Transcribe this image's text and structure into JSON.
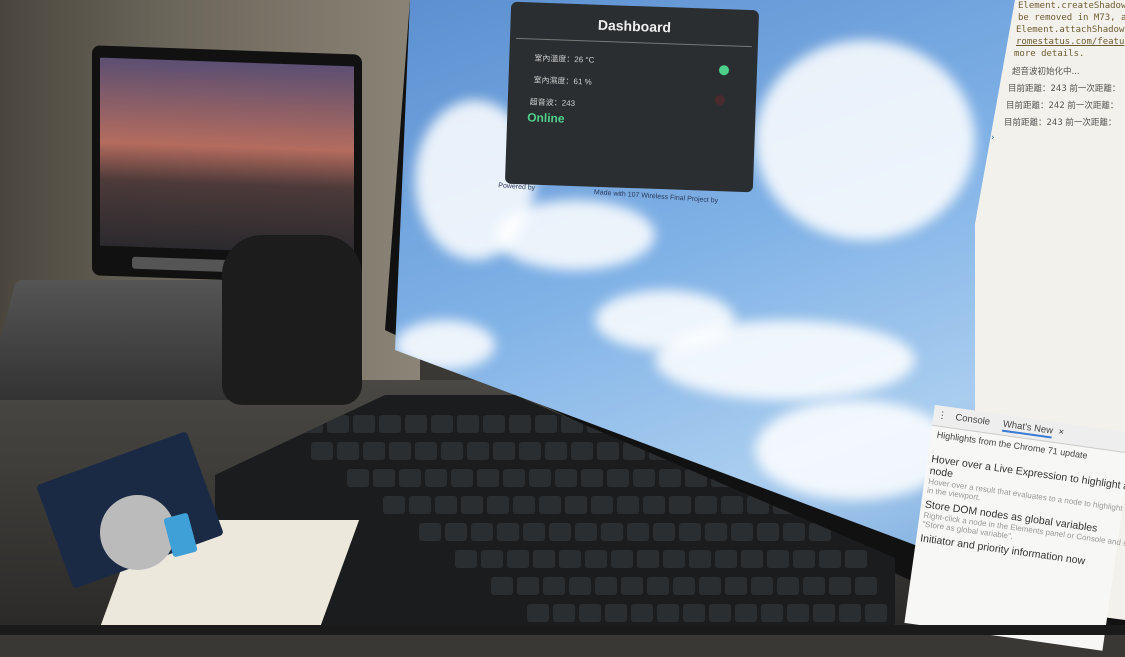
{
  "dashboard": {
    "title": "Dashboard",
    "temperature": "室內溫度：26 °C",
    "humidity": "室內濕度：61 %",
    "ultrasonic": "超音波：243",
    "status": "Online",
    "status_color": "#4fd08a",
    "footer_powered": "Powered by",
    "footer_made": "Made with 107 Wireless Final Project by"
  },
  "console": {
    "warning_lines": [
      "Element.createShadowRoot",
      "be removed in M73, a",
      "Element.attachShadow",
      "romestatus.com/featu",
      "more details."
    ],
    "logs": [
      "超音波初始化中...",
      "目前距離：243  前一次距離：",
      "目前距離：242  前一次距離：",
      "目前距離：243  前一次距離："
    ],
    "prompt": "›"
  },
  "drawer": {
    "tabs": [
      "Console",
      "What's New"
    ],
    "close": "×",
    "heading": "Highlights from the Chrome 71 update",
    "items": [
      {
        "title": "Hover over a Live Expression to highlight a DOM node",
        "desc": "Hover over a result that evaluates to a node to highlight that node in the viewport."
      },
      {
        "title": "Store DOM nodes as global variables",
        "desc": "Right-click a node in the Elements panel or Console and select \"Store as global variable\"."
      },
      {
        "title": "Initiator and priority information now",
        "desc": ""
      }
    ]
  }
}
